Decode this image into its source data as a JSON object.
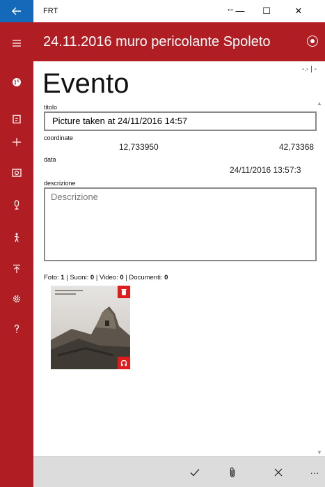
{
  "window": {
    "title": "FRT",
    "resize_glyph": "↔",
    "minimize_glyph": "—",
    "maximize_glyph": "☐",
    "close_glyph": "✕"
  },
  "header": {
    "title": "24.11.2016 muro pericolante Spoleto",
    "action_icon": "record-icon"
  },
  "sidebar": {
    "items": [
      {
        "icon": "globe-icon"
      },
      {
        "icon": "report-icon"
      },
      {
        "icon": "add-icon"
      },
      {
        "icon": "camera-icon"
      },
      {
        "icon": "microphone-icon"
      },
      {
        "icon": "walk-icon"
      },
      {
        "icon": "upload-icon"
      },
      {
        "icon": "gear-icon"
      },
      {
        "icon": "help-icon"
      }
    ]
  },
  "form": {
    "progress": "-.- | -",
    "section_title": "Evento",
    "title_label": "titolo",
    "title_value": "Picture taken at 24/11/2016 14:57",
    "coords_label": "coordinate",
    "longitude": "12,733950",
    "latitude": "42,73368",
    "date_label": "data",
    "date_value": "24/11/2016 13:57:3",
    "description_label": "descrizione",
    "description_placeholder": "Descrizione"
  },
  "media": {
    "photo_label": "Foto:",
    "photo_count": "1",
    "sound_label": "| Suoni:",
    "sound_count": "0",
    "video_label": "| Video:",
    "video_count": "0",
    "doc_label": "| Documenti:",
    "doc_count": "0"
  },
  "appbar": {
    "more_glyph": "···"
  },
  "colors": {
    "accent": "#b01e23",
    "back_button": "#1469b8",
    "badge": "#e01b1b",
    "appbar": "#dcdcdc"
  }
}
